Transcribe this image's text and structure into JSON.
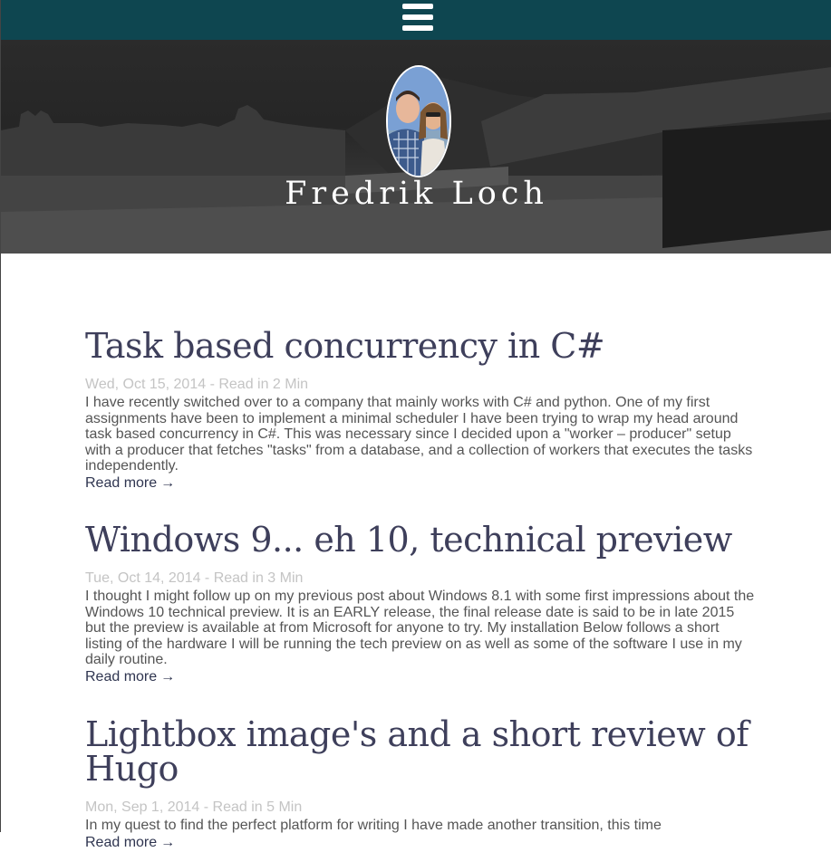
{
  "nav": {
    "menu_icon": "hamburger-icon"
  },
  "header": {
    "title": "Fredrik Loch",
    "avatar_icon": "profile-photo"
  },
  "posts": [
    {
      "title": "Task based concurrency in C#",
      "meta": "Wed, Oct 15, 2014 - Read in 2 Min",
      "excerpt": "I have recently switched over to a company that mainly works with C# and python. One of my first assignments have been to implement a minimal scheduler I have been trying to wrap my head around task based concurrency in C#. This was necessary since I decided upon a \"worker – producer\" setup with a producer that fetches \"tasks\" from a database, and a collection of workers that executes the tasks independently.",
      "read_more": "Read more",
      "arrow": "→"
    },
    {
      "title": "Windows 9... eh 10, technical preview",
      "meta": "Tue, Oct 14, 2014 - Read in 3 Min",
      "excerpt": "I thought I might follow up on my previous post about Windows 8.1 with some first impressions about the Windows 10 technical preview. It is an EARLY release, the final release date is said to be in late 2015 but the preview is available at from Microsoft for anyone to try. My installation Below follows a short listing of the hardware I will be running the tech preview on as well as some of the software I use in my daily routine.",
      "read_more": "Read more",
      "arrow": "→"
    },
    {
      "title": "Lightbox image's and a short review of Hugo",
      "meta": "Mon, Sep 1, 2014 - Read in 5 Min",
      "excerpt": "In my quest to find the perfect platform for writing I have made another transition, this time",
      "read_more": "Read more",
      "arrow": "→"
    }
  ],
  "colors": {
    "navbar": "#0e4650",
    "title": "#3e3f5b",
    "meta": "#c4c4c4",
    "body_text": "#555555"
  }
}
